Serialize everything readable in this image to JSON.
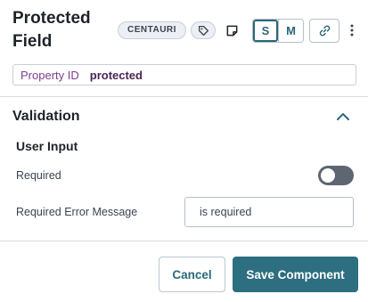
{
  "header": {
    "title": "Protected Field",
    "badge": "CENTAURI",
    "icons": [
      "tag-icon",
      "note-icon",
      "link-icon",
      "kebab-menu-icon"
    ],
    "size_options": [
      "S",
      "M"
    ],
    "selected_size": "S"
  },
  "property": {
    "label": "Property ID",
    "value": "protected"
  },
  "validation": {
    "title": "Validation",
    "subsection": "User Input",
    "required_label": "Required",
    "required_enabled": false,
    "error_message_label": "Required Error Message",
    "error_message_value": "is required"
  },
  "footer": {
    "cancel_label": "Cancel",
    "save_label": "Save Component"
  },
  "colors": {
    "accent": "#2d6e80",
    "property_label": "#7c3e8c",
    "toggle_off": "#5e6671"
  }
}
